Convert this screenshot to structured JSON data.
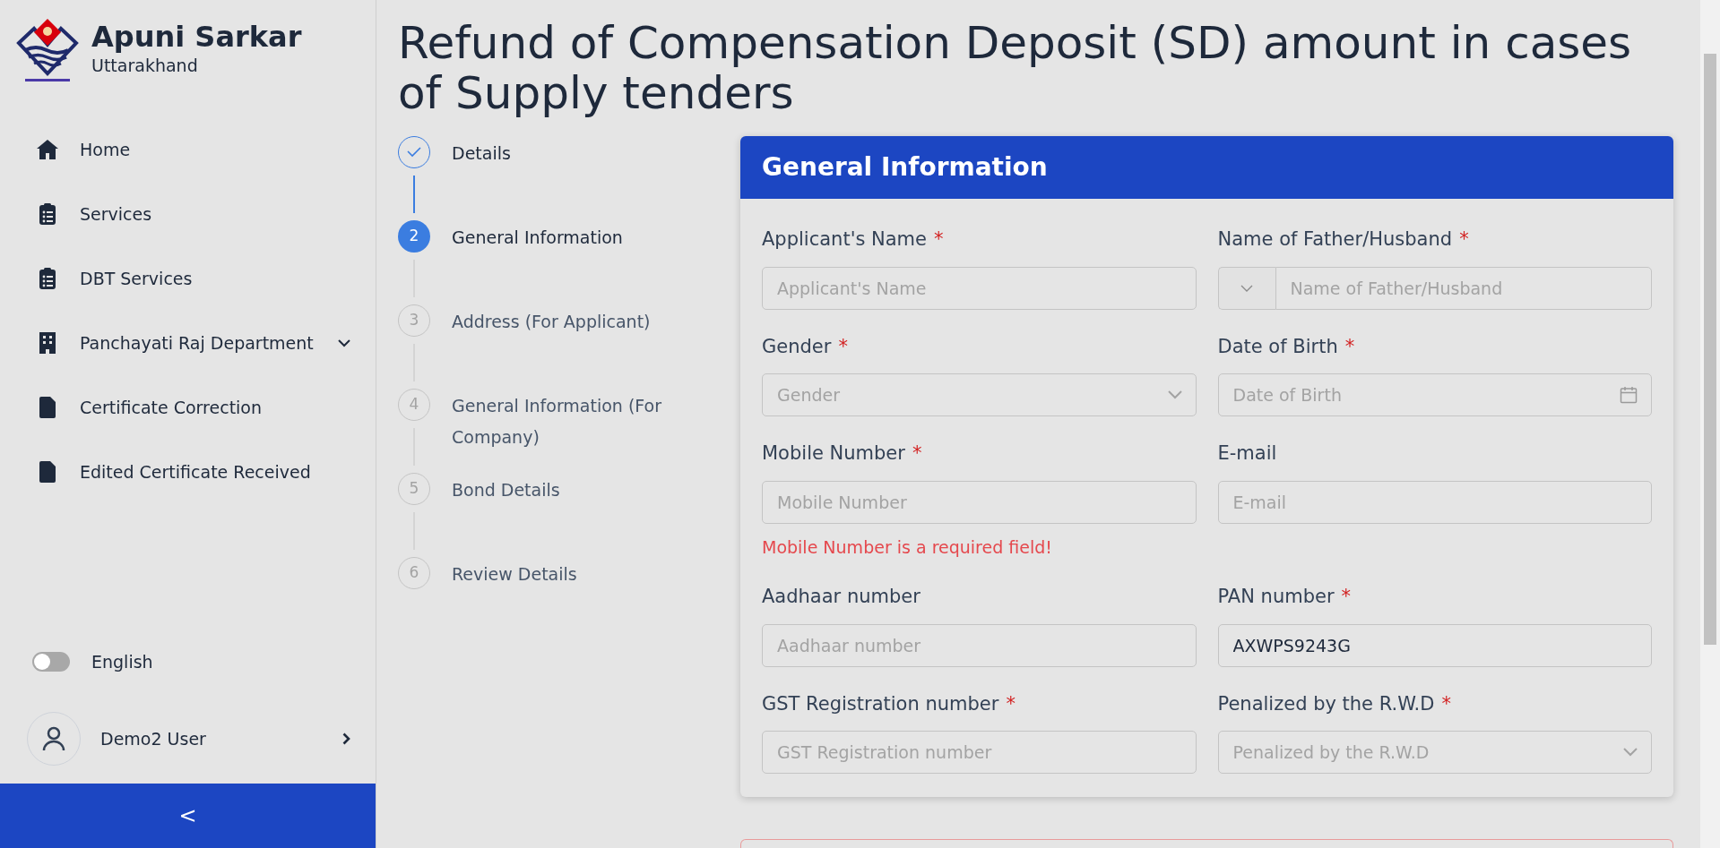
{
  "brand": {
    "title": "Apuni Sarkar",
    "subtitle": "Uttarakhand"
  },
  "sidebar": {
    "items": [
      {
        "label": "Home",
        "kind": "home",
        "expandable": false
      },
      {
        "label": "Services",
        "kind": "clipboard",
        "expandable": false
      },
      {
        "label": "DBT Services",
        "kind": "clipboard",
        "expandable": false
      },
      {
        "label": "Panchayati Raj Department",
        "kind": "building",
        "expandable": true
      },
      {
        "label": "Certificate Correction",
        "kind": "file",
        "expandable": false
      },
      {
        "label": "Edited Certificate Received",
        "kind": "file",
        "expandable": false
      }
    ],
    "language": {
      "label": "English",
      "on": false
    },
    "user": {
      "name": "Demo2 User"
    },
    "collapse": "<"
  },
  "page_title": "Refund of Compensation Deposit (SD) amount in cases of Supply tenders",
  "steps": [
    {
      "label": "Details",
      "completed": true,
      "selected": false
    },
    {
      "number": "2",
      "label": "General Information",
      "completed": false,
      "selected": true
    },
    {
      "number": "3",
      "label": "Address (For Applicant)",
      "completed": false,
      "selected": false
    },
    {
      "number": "4",
      "label": "General Information (For Company)",
      "completed": false,
      "selected": false
    },
    {
      "number": "5",
      "label": "Bond Details",
      "completed": false,
      "selected": false
    },
    {
      "number": "6",
      "label": "Review Details",
      "completed": false,
      "selected": false
    }
  ],
  "card": {
    "title": "General Information",
    "fields": [
      {
        "label": "Applicant's Name",
        "required_mark": "*",
        "kind": "text",
        "placeholder": "Applicant's Name"
      },
      {
        "label": "Name of Father/Husband",
        "required_mark": "*",
        "kind": "prefixed",
        "placeholder": "Name of Father/Husband"
      },
      {
        "label": "Gender",
        "required_mark": "*",
        "kind": "select",
        "placeholder": "Gender"
      },
      {
        "label": "Date of Birth",
        "required_mark": "*",
        "kind": "date",
        "placeholder": "Date of Birth"
      },
      {
        "label": "Mobile Number",
        "required_mark": "*",
        "kind": "text",
        "placeholder": "Mobile Number",
        "error": "Mobile Number is a required field!"
      },
      {
        "label": "E-mail",
        "kind": "text",
        "placeholder": "E-mail"
      },
      {
        "label": "Aadhaar number",
        "kind": "text",
        "placeholder": "Aadhaar number"
      },
      {
        "label": "PAN number",
        "required_mark": "*",
        "kind": "text",
        "value": "AXWPS9243G"
      },
      {
        "label": "GST Registration number",
        "required_mark": "*",
        "kind": "text",
        "placeholder": "GST Registration number"
      },
      {
        "label": "Penalized by the R.W.D",
        "required_mark": "*",
        "kind": "select",
        "placeholder": "Penalized by the R.W.D"
      }
    ]
  }
}
